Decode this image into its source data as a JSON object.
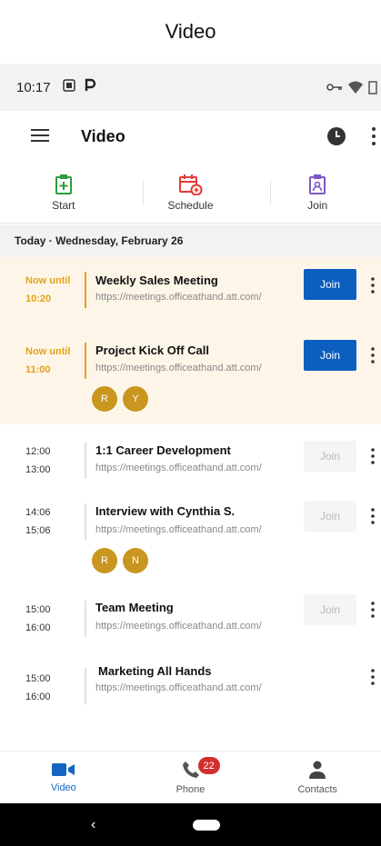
{
  "caption": "Video",
  "statusbar": {
    "time": "10:17"
  },
  "appbar": {
    "title": "Video"
  },
  "actions": [
    {
      "label": "Start",
      "color": "#2e9b3e"
    },
    {
      "label": "Schedule",
      "color": "#e53935"
    },
    {
      "label": "Join",
      "color": "#7e57c2"
    }
  ],
  "date_header": "Today · Wednesday, February 26",
  "meetings": [
    {
      "time1": "Now until",
      "time2": "10:20",
      "title": "Weekly Sales Meeting",
      "url": "https://meetings.officeathand.att.com/",
      "join": "Join",
      "state": "live",
      "avatars": []
    },
    {
      "time1": "Now until",
      "time2": "11:00",
      "title": "Project Kick Off Call",
      "url": "https://meetings.officeathand.att.com/",
      "join": "Join",
      "state": "live",
      "avatars": [
        "R",
        "Y"
      ]
    },
    {
      "time1": "12:00",
      "time2": "13:00",
      "title": "1:1 Career Development",
      "url": "https://meetings.officeathand.att.com/",
      "join": "Join",
      "state": "normal",
      "avatars": []
    },
    {
      "time1": "14:06",
      "time2": "15:06",
      "title": "Interview with Cynthia S.",
      "url": "https://meetings.officeathand.att.com/",
      "join": "Join",
      "state": "normal",
      "avatars": [
        "R",
        "N"
      ]
    },
    {
      "time1": "15:00",
      "time2": "16:00",
      "title": "Team Meeting",
      "url": "https://meetings.officeathand.att.com/",
      "join": "Join",
      "state": "normal",
      "avatars": []
    },
    {
      "time1": "15:00",
      "time2": "16:00",
      "title": "Marketing All Hands",
      "url": "https://meetings.officeathand.att.com/",
      "join": "",
      "state": "normal",
      "avatars": []
    }
  ],
  "bottomnav": [
    {
      "label": "Video",
      "icon": "video-icon",
      "active": true
    },
    {
      "label": "Phone",
      "icon": "phone-icon",
      "badge": "22"
    },
    {
      "label": "Contacts",
      "icon": "person-icon"
    }
  ]
}
